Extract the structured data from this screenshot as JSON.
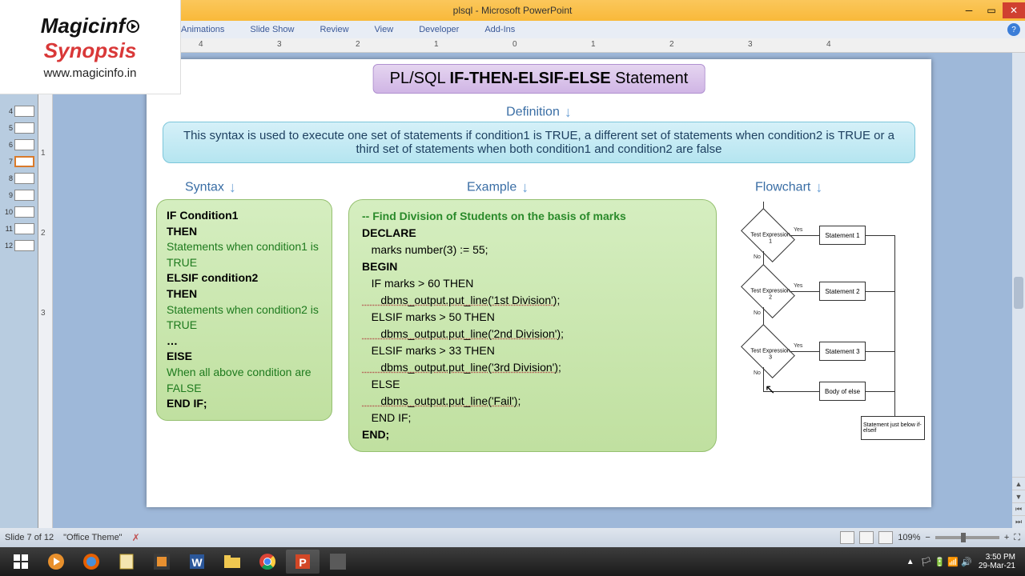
{
  "window": {
    "title": "plsql - Microsoft PowerPoint"
  },
  "ribbon": {
    "tabs": [
      "Animations",
      "Slide Show",
      "Review",
      "View",
      "Developer",
      "Add-Ins"
    ]
  },
  "ruler": {
    "marks": [
      "4",
      "3",
      "2",
      "1",
      "0",
      "1",
      "2",
      "3",
      "4"
    ]
  },
  "vruler": {
    "marks": [
      "1",
      "2",
      "3"
    ]
  },
  "logo": {
    "line1": "Magicinf",
    "line2": "Synopsis",
    "url": "www.magicinfo.in"
  },
  "thumbs": {
    "numbers": [
      "4",
      "5",
      "6",
      "7",
      "8",
      "9",
      "10",
      "11",
      "12"
    ],
    "active": "7"
  },
  "slide": {
    "title_prefix": "PL/SQL ",
    "title_bold": "IF-THEN-ELSIF-ELSE",
    "title_suffix": " Statement",
    "def_label": "Definition",
    "definition": "This syntax is used to execute one set of statements if condition1 is TRUE, a different set of statements when condition2 is TRUE or a third set of statements when both condition1 and condition2 are false",
    "col_syntax": "Syntax",
    "col_example": "Example",
    "col_flow": "Flowchart",
    "syntax": {
      "l1": "IF Condition1",
      "l2": "THEN",
      "l3": "Statements when condition1 is TRUE",
      "l4": "ELSIF condition2",
      "l5": "THEN",
      "l6": "Statements when condition2 is TRUE",
      "l7": "…",
      "l8": "EISE",
      "l9": "When all above condition are FALSE",
      "l10": "END IF;"
    },
    "example": {
      "cmt": "-- Find Division of Students on the basis of marks",
      "l1": "DECLARE",
      "l2": "   marks number(3) := 55;",
      "l3": "BEGIN",
      "l4": "   IF marks > 60 THEN",
      "l5": "      dbms_output.put_line('1st Division');",
      "l6": "   ELSIF marks > 50 THEN",
      "l7": "      dbms_output.put_line('2nd Division');",
      "l8": "   ELSIF marks > 33 THEN",
      "l9": "      dbms_output.put_line('3rd Division');",
      "l10": "   ELSE",
      "l11": "      dbms_output.put_line('Fail');",
      "l12": "   END IF;",
      "l13": "END;"
    },
    "flow": {
      "d1": "Test Expression 1",
      "d2": "Test Expression 2",
      "d3": "Test Expression 3",
      "s1": "Statement 1",
      "s2": "Statement 2",
      "s3": "Statement 3",
      "else": "Body of else",
      "end": "Statement just below if-elseif",
      "yes": "Yes",
      "no": "No"
    }
  },
  "statusbar": {
    "slide_info": "Slide 7 of 12",
    "theme": "\"Office Theme\"",
    "zoom": "109%"
  },
  "tray": {
    "time": "3:50 PM",
    "date": "29-Mar-21"
  }
}
